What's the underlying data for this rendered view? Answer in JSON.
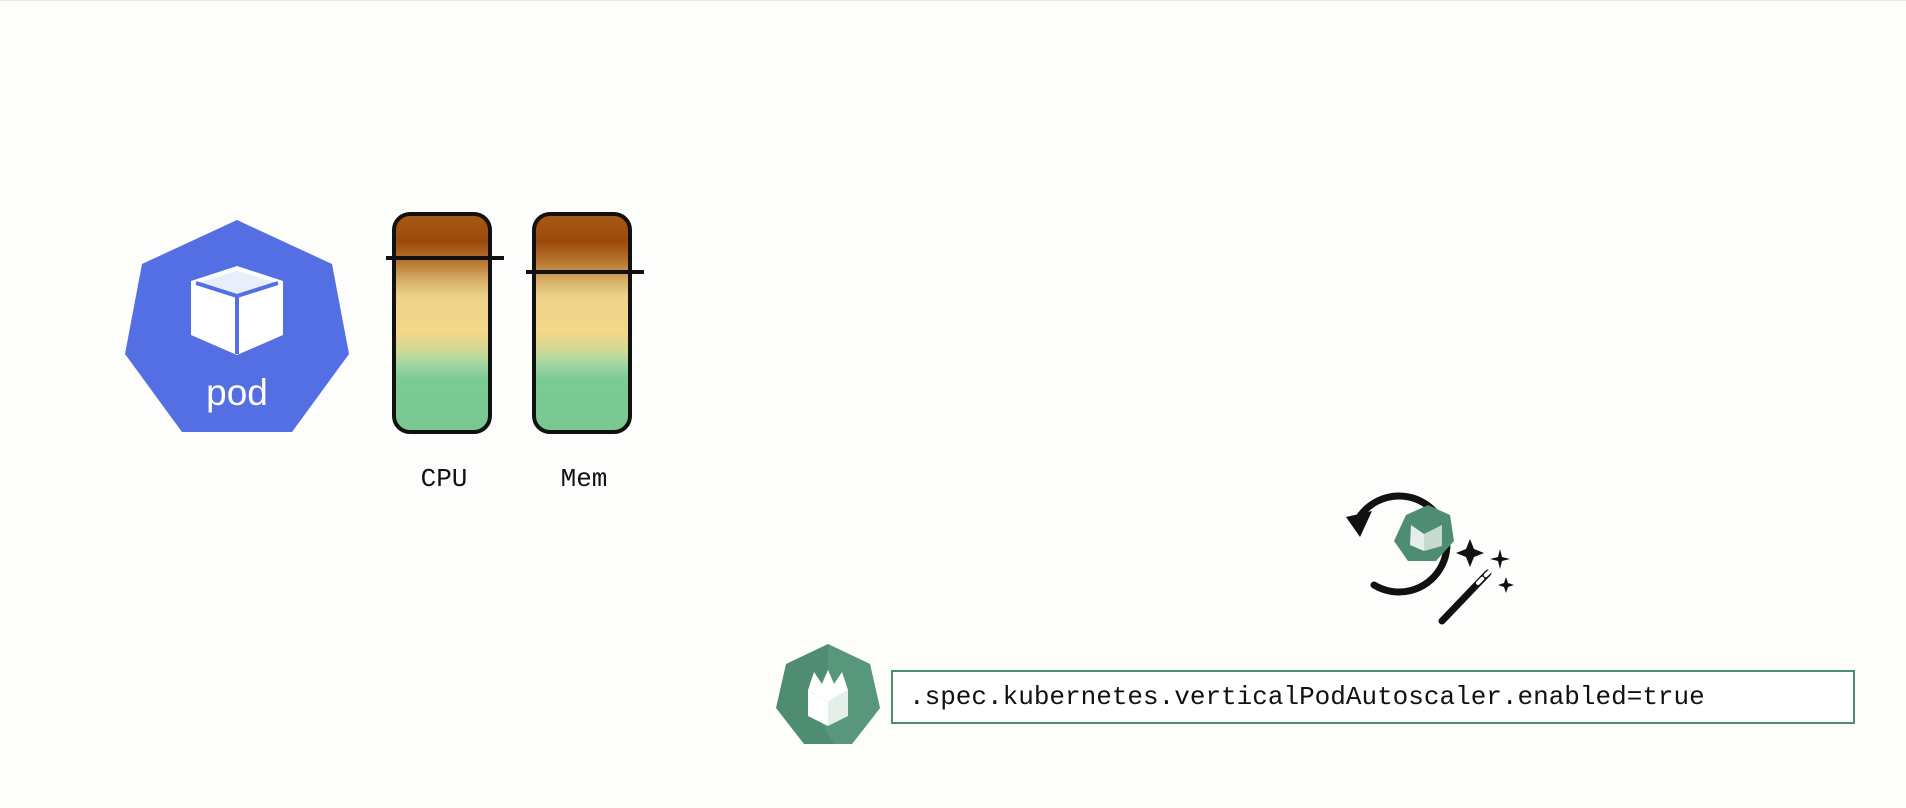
{
  "diagram": {
    "pod": {
      "label": "pod",
      "icon": "pod-cube-icon",
      "color": "#536fe3"
    },
    "resources": [
      {
        "label": "CPU",
        "limit_marker_fraction": 0.8
      },
      {
        "label": "Mem",
        "limit_marker_fraction": 0.74
      }
    ],
    "actions": {
      "restart_icon": "restart-magic-icon",
      "operator_icon": "operator-hexagon-icon"
    },
    "spec": {
      "text": ".spec.kubernetes.verticalPodAutoscaler.enabled=true",
      "border_color": "#4b8f73"
    }
  }
}
